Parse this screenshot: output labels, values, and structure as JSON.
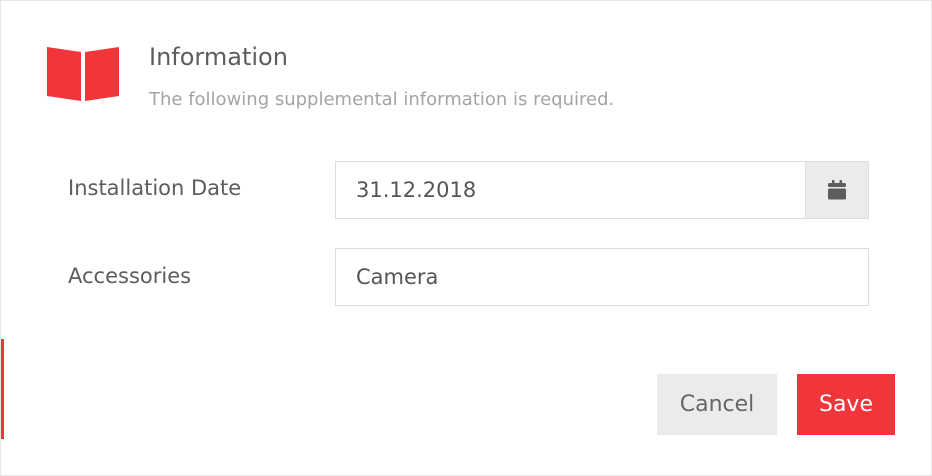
{
  "dialog": {
    "title": "Information",
    "subtitle": "The following supplemental information is required.",
    "icon": "book-icon",
    "accent_color": "#f2343b"
  },
  "form": {
    "installation_date": {
      "label": "Installation Date",
      "value": "31.12.2018",
      "button_icon": "calendar-icon"
    },
    "accessories": {
      "label": "Accessories",
      "value": "Camera"
    }
  },
  "actions": {
    "cancel_label": "Cancel",
    "save_label": "Save"
  }
}
